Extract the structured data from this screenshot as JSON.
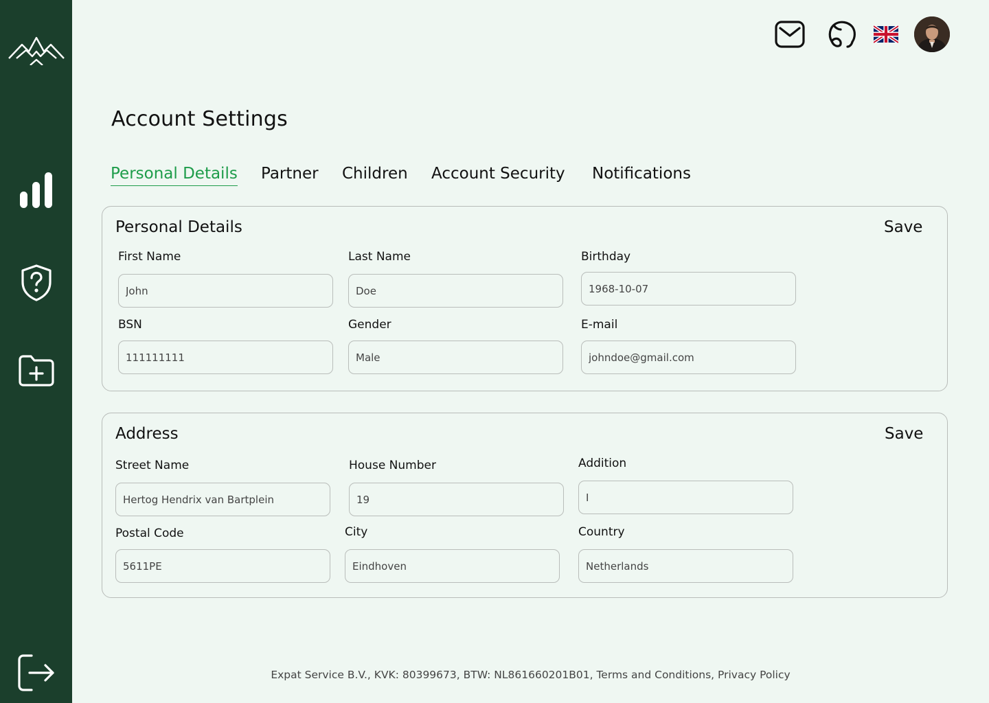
{
  "page": {
    "title": "Account Settings"
  },
  "tabs": [
    {
      "label": "Personal Details",
      "active": true
    },
    {
      "label": "Partner"
    },
    {
      "label": "Children"
    },
    {
      "label": "Account Security"
    },
    {
      "label": "Notifications"
    }
  ],
  "personal": {
    "title": "Personal Details",
    "save_label": "Save",
    "fields": [
      {
        "label": "First Name",
        "value": "John"
      },
      {
        "label": "Last Name",
        "value": "Doe"
      },
      {
        "label": "Birthday",
        "value": "1968-10-07"
      },
      {
        "label": "BSN",
        "value": "111111111"
      },
      {
        "label": "Gender",
        "value": "Male"
      },
      {
        "label": "E-mail",
        "value": "johndoe@gmail.com"
      }
    ]
  },
  "address": {
    "title": "Address",
    "save_label": "Save",
    "fields": [
      {
        "label": "Street Name",
        "value": "Hertog Hendrix van Bartplein"
      },
      {
        "label": "House Number",
        "value": "19"
      },
      {
        "label": "Addition",
        "value": "I"
      },
      {
        "label": "Postal Code",
        "value": "5611PE"
      },
      {
        "label": "City",
        "value": "Eindhoven"
      },
      {
        "label": "Country",
        "value": "Netherlands"
      }
    ]
  },
  "footer": {
    "text": "Expat Service B.V., KVK: 80399673, BTW: NL861660201B01, Terms and Conditions, Privacy Policy"
  },
  "icons": {
    "logo": "mountains-logo-icon",
    "sidebar": [
      "bar-chart-icon",
      "shield-question-icon",
      "folder-plus-icon",
      "logout-icon"
    ],
    "topbar": [
      "mail-icon",
      "support-icon",
      "uk-flag-icon",
      "avatar"
    ]
  },
  "colors": {
    "sidebar": "#1b3f2c",
    "background": "#eff7f2",
    "accent": "#1e9c4a"
  }
}
